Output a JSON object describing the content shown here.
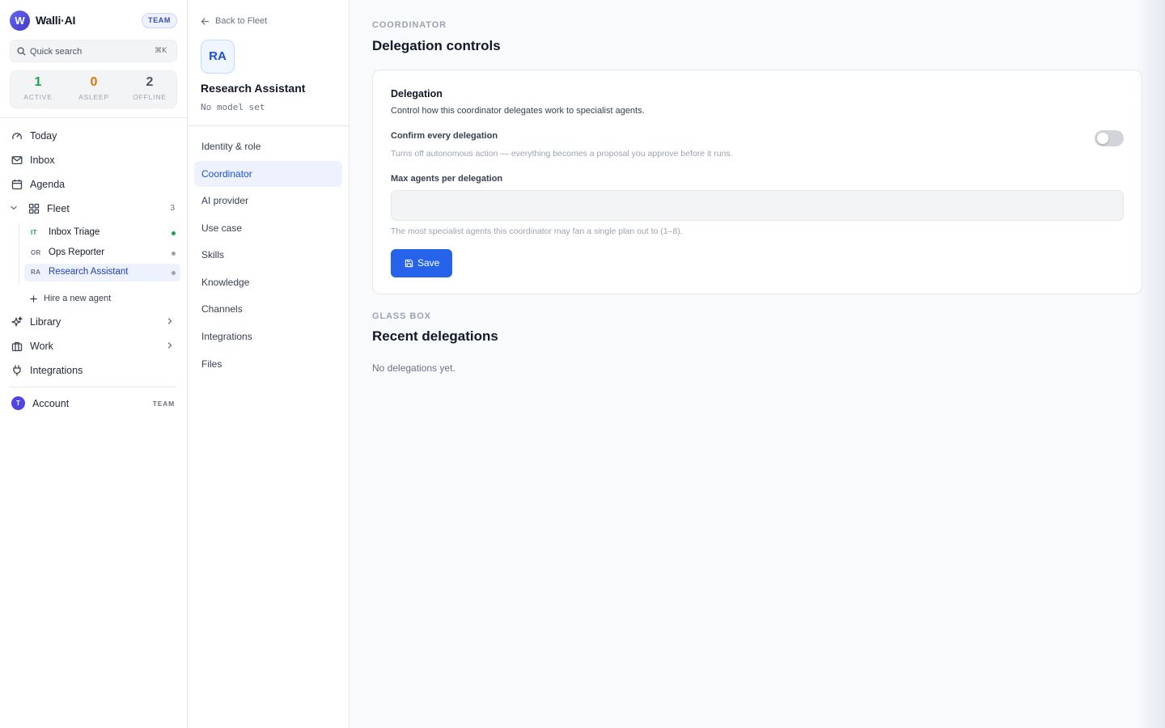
{
  "app": {
    "logo_letter": "W",
    "name": "Walli·AI",
    "plan_badge": "TEAM"
  },
  "search": {
    "placeholder": "Quick search",
    "shortcut": "⌘K"
  },
  "status": [
    {
      "count": "1",
      "label": "ACTIVE",
      "color": "#16a34a"
    },
    {
      "count": "0",
      "label": "ASLEEP",
      "color": "#d97706"
    },
    {
      "count": "2",
      "label": "OFFLINE",
      "color": "#4b5563"
    }
  ],
  "nav": {
    "today": "Today",
    "inbox": "Inbox",
    "agenda": "Agenda",
    "fleet": {
      "label": "Fleet",
      "count": "3"
    },
    "agents": [
      {
        "initials": "IT",
        "name": "Inbox Triage",
        "status": "online"
      },
      {
        "initials": "OR",
        "name": "Ops Reporter",
        "status": "offline"
      },
      {
        "initials": "RA",
        "name": "Research Assistant",
        "status": "offline"
      }
    ],
    "hire": "Hire a new agent",
    "library": "Library",
    "work": "Work",
    "integrations": "Integrations"
  },
  "account": {
    "initial": "T",
    "label": "Account",
    "plan": "TEAM"
  },
  "agent_panel": {
    "back": "Back to Fleet",
    "initials": "RA",
    "name": "Research Assistant",
    "model": "No model set",
    "sections": [
      "Identity & role",
      "Coordinator",
      "AI provider",
      "Use case",
      "Skills",
      "Knowledge",
      "Channels",
      "Integrations",
      "Files"
    ],
    "active_section": "Coordinator"
  },
  "main": {
    "coordinator": {
      "eyebrow": "COORDINATOR",
      "title": "Delegation controls"
    },
    "delegation_card": {
      "title": "Delegation",
      "description": "Control how this coordinator delegates work to specialist agents.",
      "confirm_label": "Confirm every delegation",
      "confirm_help": "Turns off autonomous action — everything becomes a proposal you approve before it runs.",
      "confirm_enabled": false,
      "max_label": "Max agents per delegation",
      "max_value": "",
      "max_help": "The most specialist agents this coordinator may fan a single plan out to (1–8).",
      "save_label": "Save"
    },
    "glass_box": {
      "eyebrow": "GLASS BOX",
      "title": "Recent delegations",
      "empty": "No delegations yet."
    }
  },
  "colors": {
    "accent": "#2563eb",
    "accent_soft": "#eef2ff",
    "online": "#16a34a"
  }
}
